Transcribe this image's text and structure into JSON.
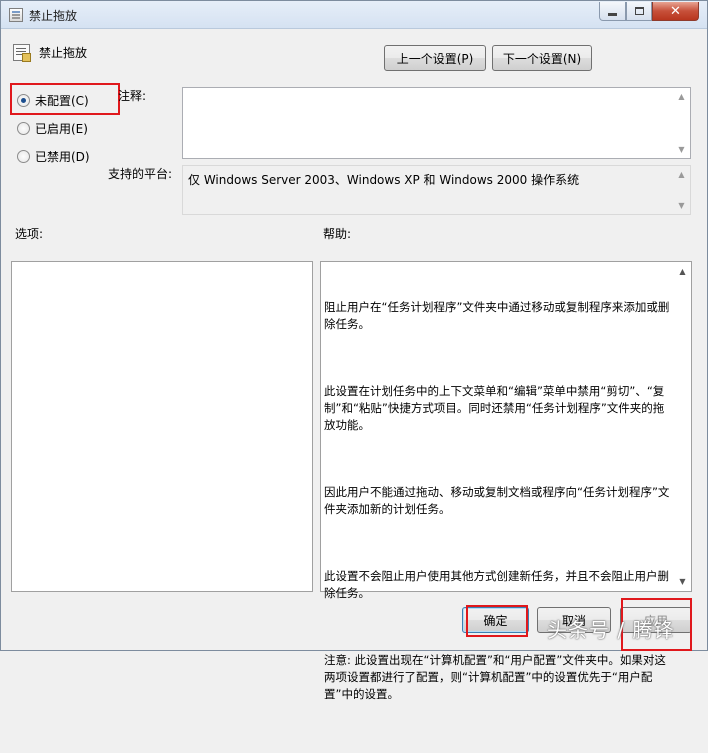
{
  "window": {
    "title": "禁止拖放",
    "controls": {
      "minimize": "",
      "maximize": "",
      "close": "✕"
    }
  },
  "policy": {
    "name": "禁止拖放"
  },
  "nav": {
    "prev_label": "上一个设置(P)",
    "next_label": "下一个设置(N)"
  },
  "state": {
    "options": [
      {
        "label": "未配置(C)",
        "checked": true
      },
      {
        "label": "已启用(E)",
        "checked": false
      },
      {
        "label": "已禁用(D)",
        "checked": false
      }
    ]
  },
  "comment": {
    "label": "注释:",
    "value": ""
  },
  "platform": {
    "label": "支持的平台:",
    "value": "仅 Windows Server 2003、Windows XP 和 Windows 2000 操作系统"
  },
  "options_section": {
    "label": "选项:"
  },
  "help_section": {
    "label": "帮助:",
    "paragraphs": [
      "阻止用户在“任务计划程序”文件夹中通过移动或复制程序来添加或删除任务。",
      "此设置在计划任务中的上下文菜单和“编辑”菜单中禁用“剪切”、“复制”和“粘贴”快捷方式项目。同时还禁用“任务计划程序”文件夹的拖放功能。",
      "因此用户不能通过拖动、移动或复制文档或程序向“任务计划程序”文件夹添加新的计划任务。",
      "此设置不会阻止用户使用其他方式创建新任务，并且不会阻止用户删除任务。",
      "注意: 此设置出现在“计算机配置”和“用户配置”文件夹中。如果对这两项设置都进行了配置，则“计算机配置”中的设置优先于“用户配置”中的设置。"
    ]
  },
  "footer": {
    "ok_label": "确定",
    "cancel_label": "取消",
    "apply_label": "应用"
  },
  "watermark": "头条号 / 腾锋",
  "colors": {
    "highlight": "#e0181c",
    "radio_dot": "#1d4f8f"
  }
}
